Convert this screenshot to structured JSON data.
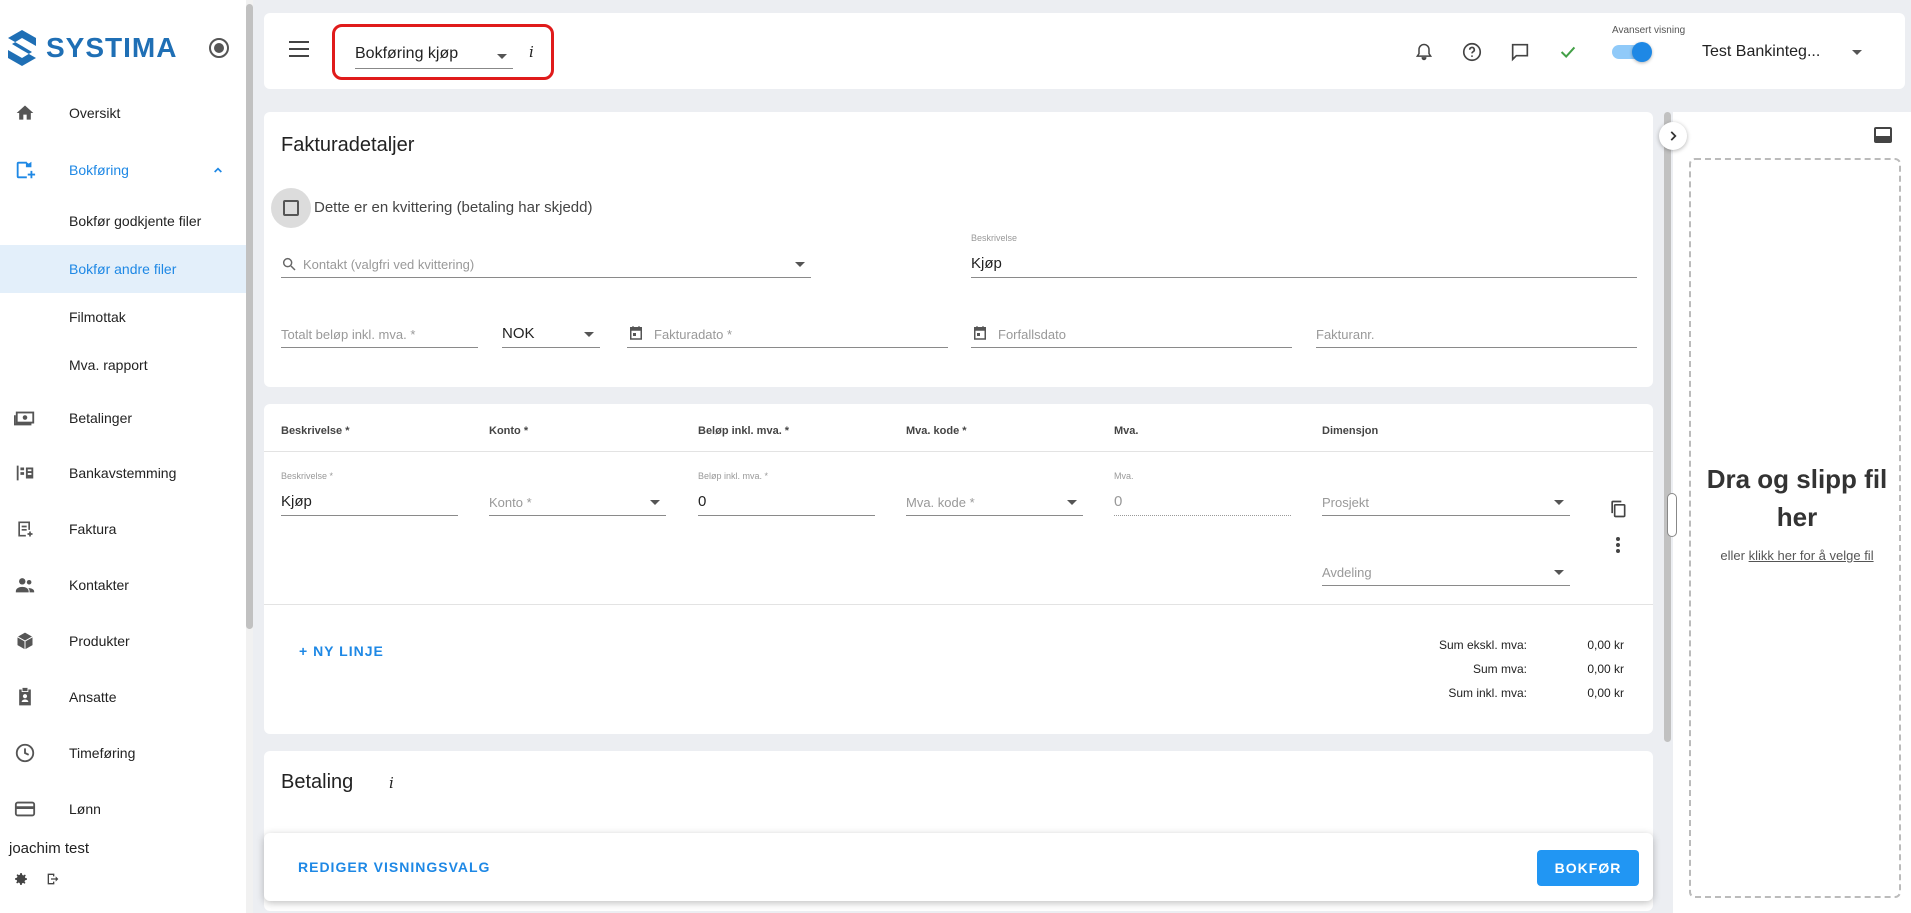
{
  "app": {
    "logo_text": "SYSTIMA"
  },
  "sidebar": {
    "items": [
      {
        "label": "Oversikt",
        "icon": "home-icon"
      },
      {
        "label": "Bokføring",
        "icon": "bookkeeping-icon"
      },
      {
        "label": "Betalinger",
        "icon": "payments-icon"
      },
      {
        "label": "Bankavstemming",
        "icon": "bank-reconciliation-icon"
      },
      {
        "label": "Faktura",
        "icon": "invoice-icon"
      },
      {
        "label": "Kontakter",
        "icon": "contacts-icon"
      },
      {
        "label": "Produkter",
        "icon": "products-icon"
      },
      {
        "label": "Ansatte",
        "icon": "employees-icon"
      },
      {
        "label": "Timeføring",
        "icon": "clock-icon"
      },
      {
        "label": "Lønn",
        "icon": "card-icon"
      }
    ],
    "sub_items": [
      {
        "label": "Bokfør godkjente filer"
      },
      {
        "label": "Bokfør andre filer"
      },
      {
        "label": "Filmottak"
      },
      {
        "label": "Mva. rapport"
      }
    ],
    "user_name": "joachim test"
  },
  "topbar": {
    "mode_value": "Bokføring kjøp",
    "mode_info": "i",
    "advanced_label": "Avansert visning",
    "company": "Test Bankinteg..."
  },
  "invoice_details": {
    "title": "Fakturadetaljer",
    "receipt_checkbox_label": "Dette er en kvittering (betaling har skjedd)",
    "contact_placeholder": "Kontakt (valgfri ved kvittering)",
    "description_label": "Beskrivelse",
    "description_value": "Kjøp",
    "total_placeholder": "Totalt beløp inkl. mva. *",
    "currency": "NOK",
    "invoice_date_placeholder": "Fakturadato *",
    "due_date_placeholder": "Forfallsdato",
    "invoice_no_placeholder": "Fakturanr."
  },
  "lines": {
    "headers": [
      "Beskrivelse *",
      "Konto *",
      "Beløp inkl. mva. *",
      "Mva. kode *",
      "Mva.",
      "Dimensjon"
    ],
    "row": {
      "desc_label": "Beskrivelse *",
      "desc_value": "Kjøp",
      "account_placeholder": "Konto *",
      "amount_label": "Beløp inkl. mva. *",
      "amount_value": "0",
      "vat_code_placeholder": "Mva. kode *",
      "vat_label": "Mva.",
      "vat_value": "0",
      "project_placeholder": "Prosjekt",
      "department_placeholder": "Avdeling"
    },
    "new_line_label": "+ NY LINJE",
    "sums": [
      {
        "label": "Sum ekskl. mva:",
        "value": "0,00 kr"
      },
      {
        "label": "Sum mva:",
        "value": "0,00 kr"
      },
      {
        "label": "Sum inkl. mva:",
        "value": "0,00 kr"
      }
    ]
  },
  "payment": {
    "title": "Betaling",
    "info": "i"
  },
  "bottom_bar": {
    "edit_view_label": "REDIGER VISNINGSVALG",
    "submit_label": "BOKFØR"
  },
  "dropzone": {
    "title": "Dra og slipp fil her",
    "prefix": "eller",
    "link": "klikk her for å velge fil"
  },
  "colors": {
    "accent": "#1e88e5",
    "brand": "#1f6fb5",
    "highlight_border": "#e01b1b",
    "success": "#43a047"
  }
}
